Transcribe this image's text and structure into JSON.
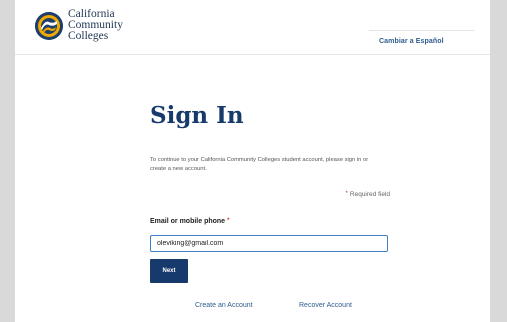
{
  "header": {
    "logo": {
      "line1": "California",
      "line2": "Community",
      "line3": "Colleges"
    },
    "language_link": "Cambiar a Español"
  },
  "signin": {
    "title": "Sign In",
    "description": "To continue to your California Community Colleges student account, please sign in or create a new account.",
    "required_note": "Required field",
    "required_marker": "*",
    "email_label": "Email or mobile phone",
    "email_value": "oleviking@gmail.com",
    "next_label": "Next",
    "create_account_link": "Create an Account",
    "recover_account_link": "Recover Account"
  },
  "colors": {
    "brand_navy": "#163a6b",
    "link_blue": "#2d5c8f",
    "required_red": "#c0392b",
    "input_focus": "#3f7fc6"
  }
}
